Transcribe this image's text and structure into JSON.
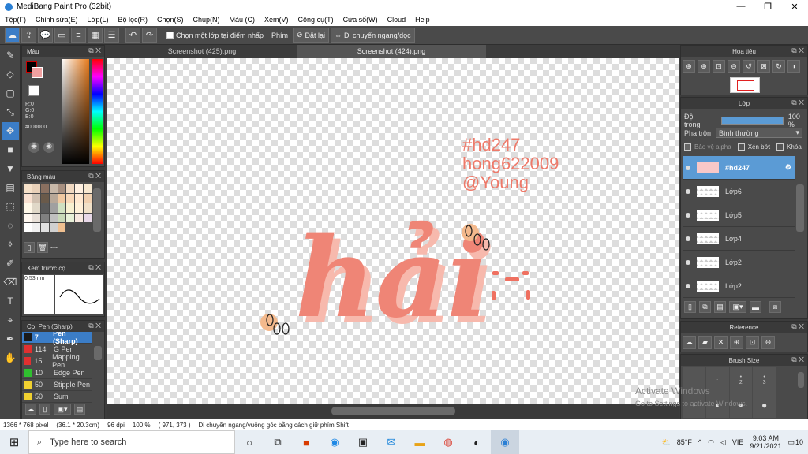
{
  "window": {
    "title": "MediBang Paint Pro (32bit)"
  },
  "menu": [
    "Tệp(F)",
    "Chỉnh sửa(E)",
    "Lớp(L)",
    "Bộ lọc(R)",
    "Chọn(S)",
    "Chụp(N)",
    "Màu (C)",
    "Xem(V)",
    "Công cụ(T)",
    "Cửa sổ(W)",
    "Cloud",
    "Help"
  ],
  "toolbar": {
    "select_layer_label": "Chọn một lớp tại điểm nhấp",
    "shortcut_label": "Phím",
    "reset_label": "Đặt lại",
    "move_label": "Di chuyển ngang/dọc"
  },
  "tabs": [
    "Screenshot (425).png",
    "Screenshot (424).png"
  ],
  "color_panel": {
    "title": "Màu",
    "r": "R:0",
    "g": "G:0",
    "b": "B:0",
    "hex": "#000000"
  },
  "palette_panel": {
    "title": "Bảng màu",
    "dash": "---"
  },
  "brush_preview": {
    "title": "Xem trước cọ",
    "size": "0.53mm"
  },
  "brush_panel": {
    "title": "Cọ: Pen (Sharp)",
    "items": [
      {
        "num": "7",
        "name": "Pen (Sharp)",
        "color": "#1a1a1a"
      },
      {
        "num": "114",
        "name": "G Pen",
        "color": "#e03030"
      },
      {
        "num": "15",
        "name": "Mapping Pen",
        "color": "#e03030"
      },
      {
        "num": "10",
        "name": "Edge Pen",
        "color": "#2fbf2f"
      },
      {
        "num": "50",
        "name": "Stipple Pen",
        "color": "#f0d030"
      },
      {
        "num": "50",
        "name": "Sumi",
        "color": "#f0d030"
      }
    ]
  },
  "navigator": {
    "title": "Hoa tiêu"
  },
  "layer_panel": {
    "title": "Lớp",
    "opacity_label": "Độ trong",
    "opacity_value": "100 %",
    "blend_label": "Pha trộn",
    "blend_value": "Bình thường",
    "protect_alpha": "Bảo vệ alpha",
    "clipping": "Xén bớt",
    "lock": "Khóa",
    "layers": [
      {
        "name": "#hd247",
        "selected": true
      },
      {
        "name": "Lớp6",
        "selected": false
      },
      {
        "name": "Lớp5",
        "selected": false
      },
      {
        "name": "Lớp4",
        "selected": false
      },
      {
        "name": "Lớp2",
        "selected": false
      },
      {
        "name": "Lớp2",
        "selected": false
      }
    ]
  },
  "reference_panel": {
    "title": "Reference"
  },
  "brush_size_panel": {
    "title": "Brush Size",
    "values": [
      "2",
      "3"
    ]
  },
  "artwork": {
    "line1": "#hd247",
    "line2": "hong622009",
    "line3": "@Young",
    "word": "hải",
    "color": "#ee7a6a"
  },
  "watermark": {
    "line1": "Activate Windows",
    "line2": "Go to Settings to activate Windows."
  },
  "status": {
    "size": "1366 * 768 pixel",
    "cm": "(36.1 * 20.3cm)",
    "dpi": "96 dpi",
    "zoom": "100 %",
    "pos": "( 971, 373 )",
    "hint": "Di chuyển ngang/vuông góc bằng cách giữ phím Shift"
  },
  "taskbar": {
    "search_placeholder": "Type here to search",
    "weather": "85°F",
    "lang": "VIE",
    "time": "9:03 AM",
    "date": "9/21/2021",
    "notif": "10"
  }
}
